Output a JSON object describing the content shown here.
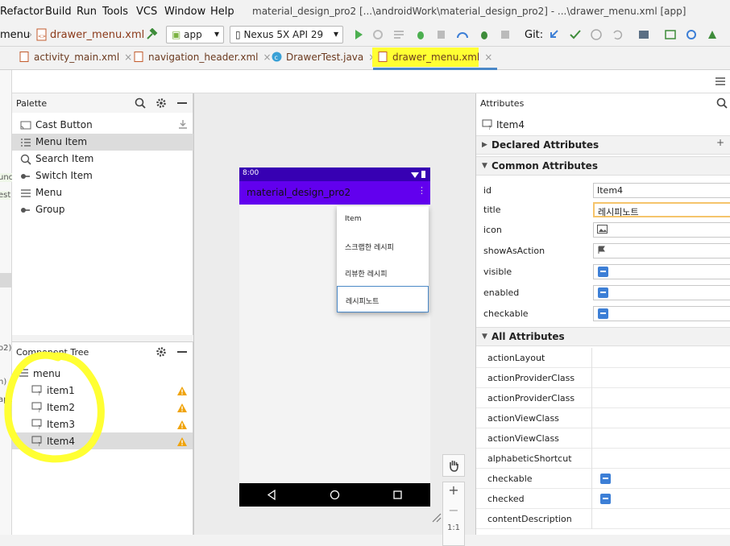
{
  "menubar": {
    "items": [
      "Refactor",
      "Build",
      "Run",
      "Tools",
      "VCS",
      "Window",
      "Help"
    ],
    "title": "material_design_pro2 [...\\androidWork\\material_design_pro2] - ...\\drawer_menu.xml [app]"
  },
  "toolbar": {
    "breadcrumb_root": "menu",
    "breadcrumb_file": "drawer_menu.xml",
    "module_combo": "app",
    "device_combo": "Nexus 5X API 29",
    "git_label": "Git:"
  },
  "tabs": [
    {
      "label": "activity_main.xml",
      "close": "×"
    },
    {
      "label": "navigation_header.xml",
      "close": "×"
    },
    {
      "label": "DrawerTest.java",
      "close": "×"
    },
    {
      "label": "drawer_menu.xml",
      "close": "×"
    }
  ],
  "left_strip_fragments": [
    "unc",
    "est",
    "o2)",
    "n)",
    "app"
  ],
  "palette": {
    "title": "Palette",
    "items": [
      {
        "label": "Cast Button",
        "icon": "cast-icon"
      },
      {
        "label": "Menu Item",
        "icon": "menu-item-icon"
      },
      {
        "label": "Search Item",
        "icon": "search-icon"
      },
      {
        "label": "Switch Item",
        "icon": "switch-icon"
      },
      {
        "label": "Menu",
        "icon": "menu-icon"
      },
      {
        "label": "Group",
        "icon": "group-icon"
      }
    ],
    "selected_index": 1
  },
  "component_tree": {
    "title": "Component Tree",
    "root": "menu",
    "items": [
      "item1",
      "Item2",
      "Item3",
      "Item4"
    ],
    "selected_index": 3
  },
  "phone": {
    "status_time": "8:00",
    "app_title": "material_design_pro2",
    "overflow": "⋮",
    "menu_items": [
      "Item",
      "스크랩한 레시피",
      "리뷰한 레시피",
      "레시피노트"
    ],
    "selected_menu_index": 3
  },
  "zoom_controls": [
    "+",
    "−",
    "1:1"
  ],
  "attributes": {
    "title": "Attributes",
    "component": "Item4",
    "sections": {
      "declared": "Declared Attributes",
      "common": "Common Attributes",
      "all": "All Attributes"
    },
    "common": [
      {
        "name": "id",
        "value": "Item4",
        "kind": "text"
      },
      {
        "name": "title",
        "value": "레시피노트",
        "kind": "text-focus"
      },
      {
        "name": "icon",
        "value": "",
        "kind": "image"
      },
      {
        "name": "showAsAction",
        "value": "",
        "kind": "flag"
      },
      {
        "name": "visible",
        "value": "",
        "kind": "bool"
      },
      {
        "name": "enabled",
        "value": "",
        "kind": "bool"
      },
      {
        "name": "checkable",
        "value": "",
        "kind": "bool"
      }
    ],
    "all": [
      {
        "name": "actionLayout",
        "bool": false
      },
      {
        "name": "actionProviderClass",
        "bool": false
      },
      {
        "name": "actionProviderClass",
        "bool": false
      },
      {
        "name": "actionViewClass",
        "bool": false
      },
      {
        "name": "actionViewClass",
        "bool": false
      },
      {
        "name": "alphabeticShortcut",
        "bool": false
      },
      {
        "name": "checkable",
        "bool": true
      },
      {
        "name": "checked",
        "bool": true
      },
      {
        "name": "contentDescription",
        "bool": false
      }
    ]
  },
  "colors": {
    "status_bar": "#3700b3",
    "app_bar": "#6200ee",
    "highlight": "#ffff33",
    "bool_icon": "#3d7fd6",
    "warning": "#f0a30a"
  }
}
